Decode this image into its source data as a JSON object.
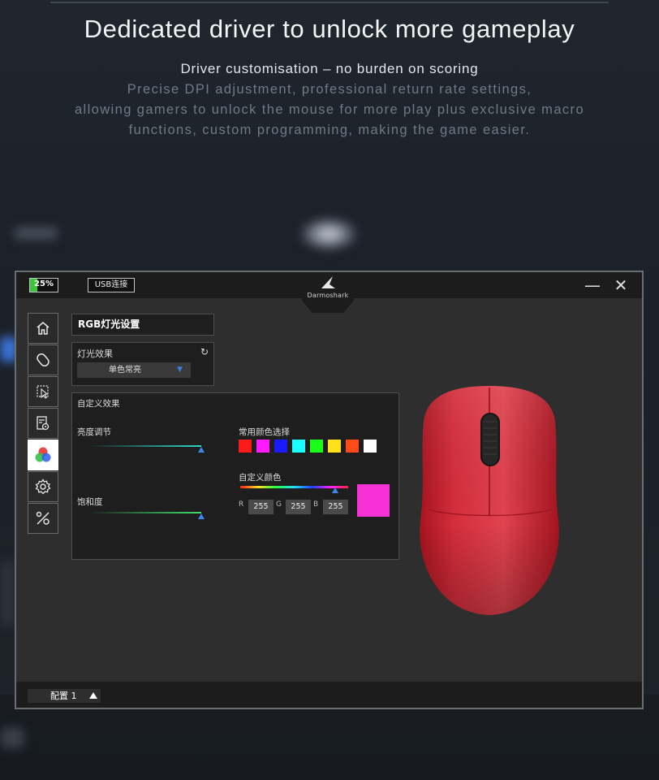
{
  "banner": {
    "headline": "Dedicated driver to unlock more gameplay",
    "subtitle": "Driver customisation – no burden on scoring",
    "description_lines": [
      "Precise DPI adjustment, professional return rate settings,",
      "allowing gamers to unlock the mouse for more play plus exclusive macro",
      "functions, custom programming, making the game easier."
    ]
  },
  "window": {
    "battery": {
      "label": "25%",
      "level": 0.25,
      "color": "#3cc53c"
    },
    "connection": "USB连接",
    "brand": "Darmoshark",
    "controls": {
      "minimize": "—",
      "close": "✕"
    }
  },
  "sidebar": {
    "items": [
      {
        "icon": "home-icon",
        "active": false
      },
      {
        "icon": "mouse-icon",
        "active": false
      },
      {
        "icon": "cursor-icon",
        "active": false
      },
      {
        "icon": "macro-icon",
        "active": false
      },
      {
        "icon": "rgb-icon",
        "active": true
      },
      {
        "icon": "gear-icon",
        "active": false
      },
      {
        "icon": "tools-icon",
        "active": false
      }
    ]
  },
  "rgb": {
    "section_title": "RGB灯光设置",
    "effect_label": "灯光效果",
    "effect_value": "单色常亮",
    "custom_title": "自定义效果",
    "brightness_label": "亮度调节",
    "saturation_label": "饱和度",
    "brightness_level": 1.0,
    "saturation_level": 1.0,
    "common_colors_label": "常用颜色选择",
    "common_colors": [
      "#ff1a1a",
      "#ff1aff",
      "#1a1aff",
      "#1affff",
      "#1aff1a",
      "#ffe01a",
      "#ff4a1a",
      "#ffffff"
    ],
    "custom_color_label": "自定义颜色",
    "hue_level": 0.88,
    "r_label": "R",
    "r_value": "255",
    "g_label": "G",
    "g_value": "255",
    "b_label": "B",
    "b_value": "255",
    "preview_color": "#f532d3"
  },
  "footer": {
    "profile_label": "配置 1"
  },
  "colors": {
    "accent": "#3d86f0",
    "mouse_body": "#d32a38"
  }
}
